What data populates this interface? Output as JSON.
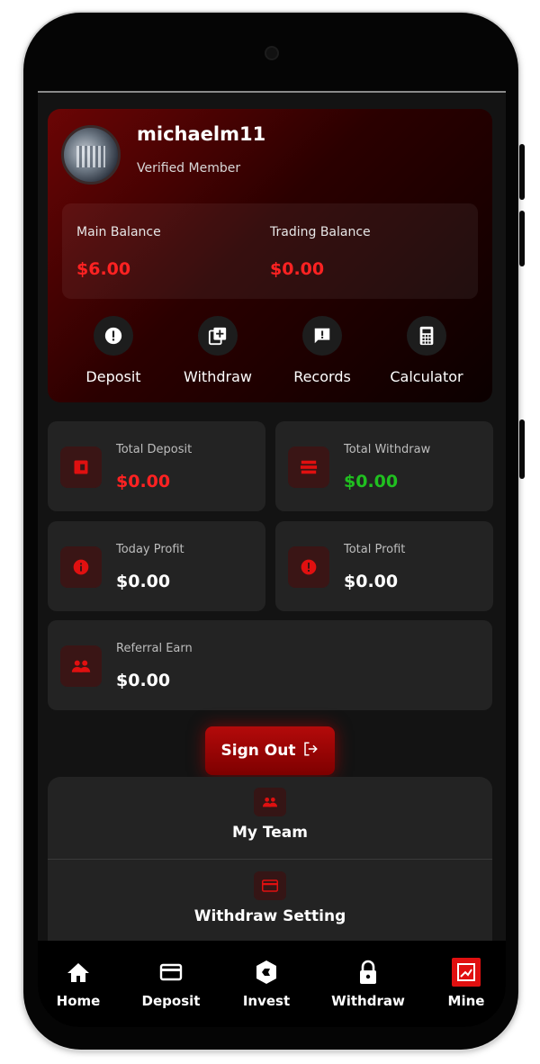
{
  "profile": {
    "username": "michaelm11",
    "status": "Verified Member",
    "avatar_icon": "user-avatar"
  },
  "balances": {
    "main_label": "Main Balance",
    "main_value": "$6.00",
    "trading_label": "Trading Balance",
    "trading_value": "$0.00"
  },
  "actions": [
    {
      "label": "Deposit",
      "icon": "alert-circle-icon"
    },
    {
      "label": "Withdraw",
      "icon": "add-box-icon"
    },
    {
      "label": "Records",
      "icon": "message-alert-icon"
    },
    {
      "label": "Calculator",
      "icon": "calculator-icon"
    }
  ],
  "stats": {
    "total_deposit": {
      "label": "Total Deposit",
      "value": "$0.00",
      "icon": "wallet-icon"
    },
    "total_withdraw": {
      "label": "Total Withdraw",
      "value": "$0.00",
      "icon": "money-stack-icon"
    },
    "today_profit": {
      "label": "Today Profit",
      "value": "$0.00",
      "icon": "info-icon"
    },
    "total_profit": {
      "label": "Total Profit",
      "value": "$0.00",
      "icon": "alert-icon"
    },
    "referral_earn": {
      "label": "Referral Earn",
      "value": "$0.00",
      "icon": "group-icon"
    }
  },
  "signout": {
    "label": "Sign Out",
    "icon": "logout-icon"
  },
  "menu": [
    {
      "label": "My Team",
      "icon": "group-icon"
    },
    {
      "label": "Withdraw Setting",
      "icon": "card-icon"
    }
  ],
  "nav": [
    {
      "label": "Home",
      "icon": "home-icon"
    },
    {
      "label": "Deposit",
      "icon": "card-icon"
    },
    {
      "label": "Invest",
      "icon": "hexagon-icon"
    },
    {
      "label": "Withdraw",
      "icon": "lock-icon"
    },
    {
      "label": "Mine",
      "icon": "chart-box-icon",
      "active": true
    }
  ],
  "colors": {
    "accent": "#e01010",
    "negative": "#ff2222",
    "positive": "#20c020",
    "card": "#232323",
    "background": "#131313"
  }
}
